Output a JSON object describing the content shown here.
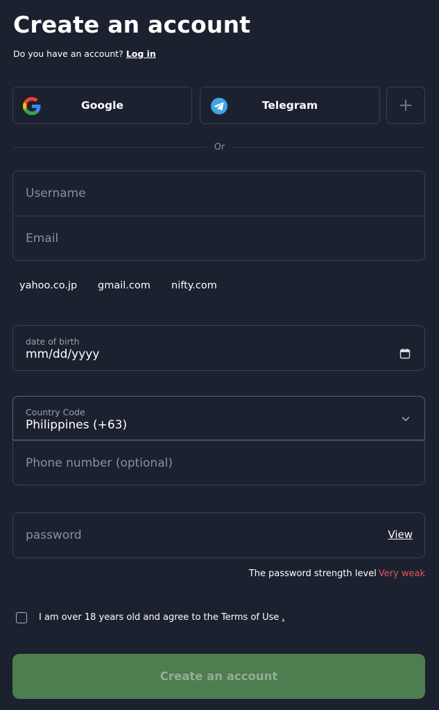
{
  "header": {
    "title": "Create an account",
    "login_prompt": "Do you have an account?",
    "login_link": "Log in"
  },
  "social": {
    "google_label": "Google",
    "telegram_label": "Telegram",
    "more_label": "+",
    "google_icon": "google-icon",
    "telegram_icon": "telegram-icon"
  },
  "divider_text": "Or",
  "form": {
    "username_placeholder": "Username",
    "email_placeholder": "Email",
    "email_domains": [
      "yahoo.co.jp",
      "gmail.com",
      "nifty.com"
    ],
    "dob_label": "date of birth",
    "dob_value": "mm/dd/yyyy",
    "country_label": "Country Code",
    "country_value": "Philippines (+63)",
    "phone_placeholder": "Phone number (optional)",
    "password_placeholder": "password",
    "view_label": "View",
    "strength_label": "The password strength level",
    "strength_value": "Very weak",
    "terms_text": "I am over 18 years old and agree to the Terms of Use",
    "terms_link": ".",
    "submit_label": "Create an account"
  },
  "colors": {
    "background": "#1c2130",
    "border": "#3a4152",
    "submit_bg": "#4e7d4f",
    "weak": "#e05a5a"
  }
}
